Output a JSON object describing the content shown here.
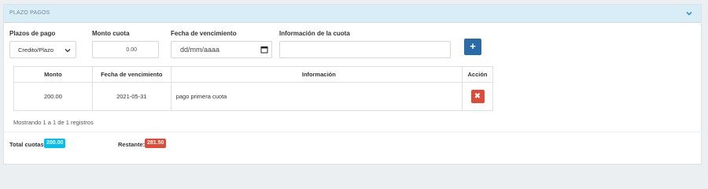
{
  "panel": {
    "title": "PLAZO PAGOS",
    "collapse_icon": "chevron-down-icon"
  },
  "form": {
    "plazos_label": "Plazos de pago",
    "plazos_value": "Credito/Plazo",
    "monto_label": "Monto cuota",
    "monto_value": "0.00",
    "fecha_label": "Fecha de vencimiento",
    "fecha_value": "dd/mm/aaaa",
    "info_label": "Información de la cuota",
    "info_value": "",
    "add_label": "+"
  },
  "table": {
    "headers": [
      "Monto",
      "Fecha de vencimiento",
      "Información",
      "Acción"
    ],
    "rows": [
      {
        "monto": "200.00",
        "fecha": "2021-05-31",
        "info": "pago primera cuota",
        "delete_label": "✖"
      }
    ]
  },
  "records_text": "Mostrando 1 a 1 de 1 registros",
  "totals": {
    "total_label": "Total cuotas:",
    "total_value": "200.00",
    "restante_label": "Restante:",
    "restante_value": "281.50"
  },
  "colors": {
    "header_bg": "#d9edf7",
    "add_button": "#2a6aa5",
    "delete_button": "#dd4b39",
    "total_badge": "#00c0ef",
    "restante_badge": "#dd4b39"
  }
}
